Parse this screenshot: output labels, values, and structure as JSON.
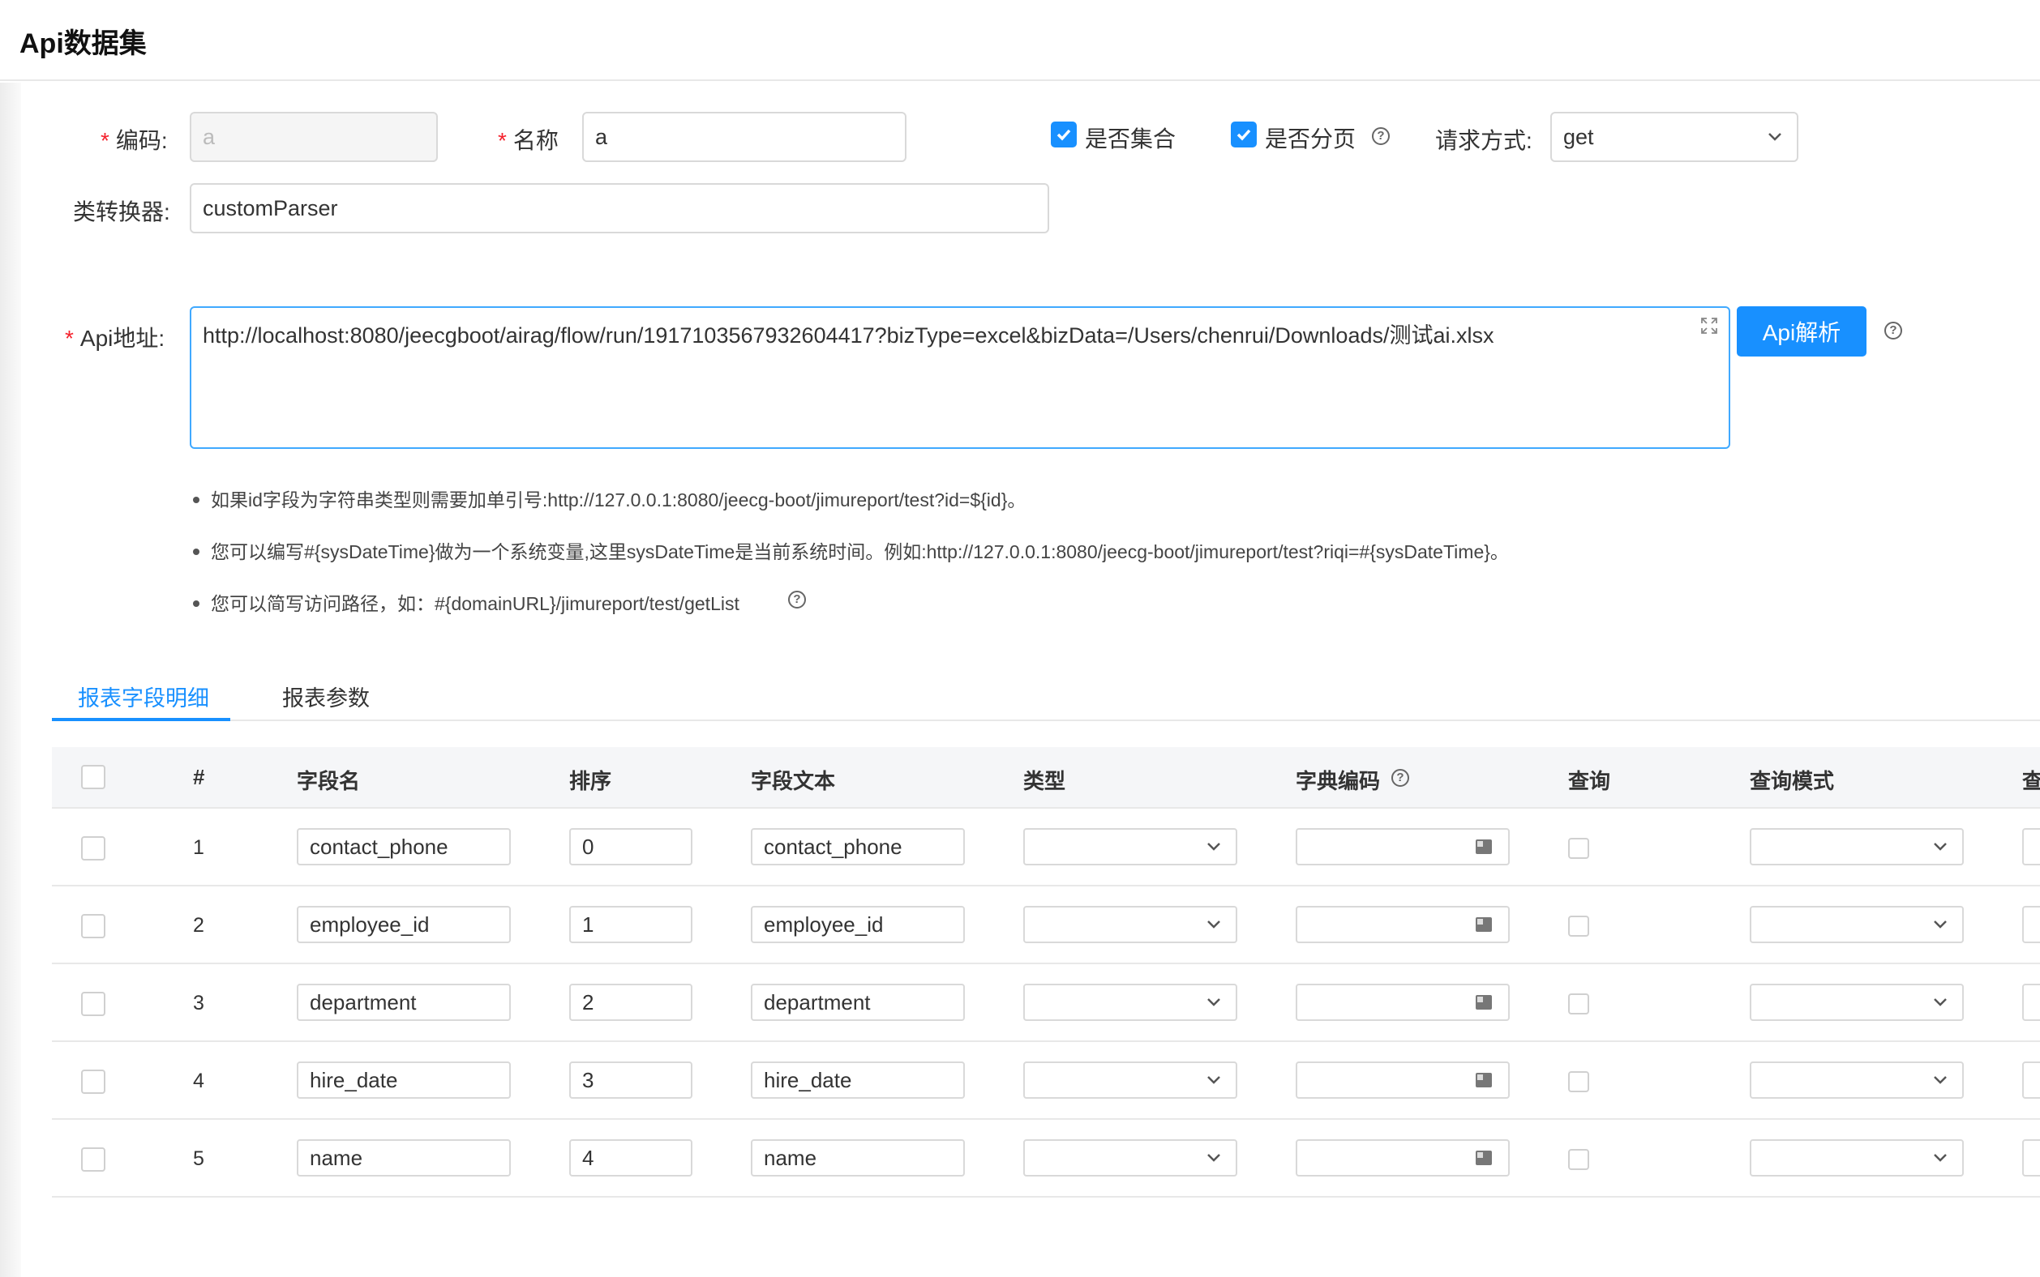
{
  "page": {
    "title": "Api数据集"
  },
  "form": {
    "code": {
      "label": "编码:",
      "value": "a"
    },
    "name": {
      "label": "名称",
      "value": "a"
    },
    "is_collection": {
      "label": "是否集合",
      "checked": true
    },
    "is_paging": {
      "label": "是否分页",
      "checked": true
    },
    "method": {
      "label": "请求方式:",
      "value": "get"
    },
    "converter": {
      "label": "类转换器:",
      "value": "customParser"
    },
    "api_url": {
      "label": "Api地址:",
      "value": "http://localhost:8080/jeecgboot/airag/flow/run/1917103567932604417?bizType=excel&bizData=/Users/chenrui/Downloads/测试ai.xlsx"
    },
    "parse_button": "Api解析",
    "required_mark": "*"
  },
  "tips": [
    "如果id字段为字符串类型则需要加单引号:http://127.0.0.1:8080/jeecg-boot/jimureport/test?id=${id}。",
    "您可以编写#{sysDateTime}做为一个系统变量,这里sysDateTime是当前系统时间。例如:http://127.0.0.1:8080/jeecg-boot/jimureport/test?riqi=#{sysDateTime}。",
    "您可以简写访问路径，如：#{domainURL}/jimureport/test/getList"
  ],
  "tabs": [
    {
      "label": "报表字段明细",
      "active": true
    },
    {
      "label": "报表参数",
      "active": false
    }
  ],
  "table": {
    "headers": {
      "index": "#",
      "field_name": "字段名",
      "order": "排序",
      "field_text": "字段文本",
      "type": "类型",
      "dict_code": "字典编码",
      "query": "查询",
      "query_mode": "查询模式",
      "extra": "查"
    },
    "rows": [
      {
        "index": "1",
        "field_name": "contact_phone",
        "order": "0",
        "field_text": "contact_phone"
      },
      {
        "index": "2",
        "field_name": "employee_id",
        "order": "1",
        "field_text": "employee_id"
      },
      {
        "index": "3",
        "field_name": "department",
        "order": "2",
        "field_text": "department"
      },
      {
        "index": "4",
        "field_name": "hire_date",
        "order": "3",
        "field_text": "hire_date"
      },
      {
        "index": "5",
        "field_name": "name",
        "order": "4",
        "field_text": "name"
      }
    ]
  },
  "colors": {
    "primary": "#1890ff",
    "required": "#f5222d",
    "border": "#d9d9d9"
  },
  "icons": [
    "help-circle-icon",
    "check-icon",
    "chevron-down-icon",
    "expand-icon",
    "dict-picker-icon"
  ]
}
